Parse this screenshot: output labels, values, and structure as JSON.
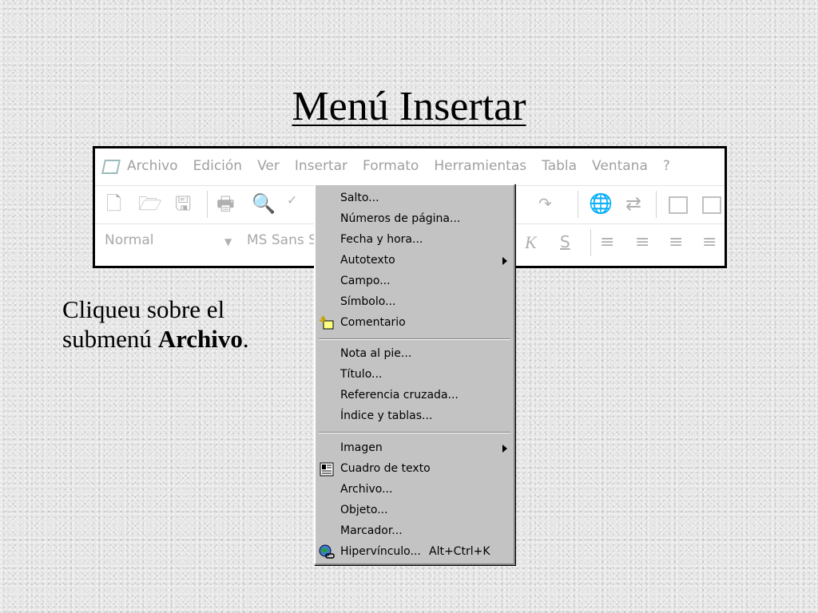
{
  "slide": {
    "title": "Menú Insertar",
    "caption_text": "Cliqueu sobre el submenú ",
    "caption_bold": "Archivo",
    "caption_end": "."
  },
  "menubar": {
    "items": [
      "Archivo",
      "Edición",
      "Ver",
      "Insertar",
      "Formato",
      "Herramientas",
      "Tabla",
      "Ventana",
      "?"
    ]
  },
  "formatting": {
    "style_value": "Normal",
    "font_value": "MS Sans S",
    "italic_label": "K",
    "underline_label": "S"
  },
  "insert_menu": {
    "group1": [
      {
        "label": "Salto...",
        "submenu": false,
        "icon": null
      },
      {
        "label": "Números de página...",
        "submenu": false,
        "icon": null
      },
      {
        "label": "Fecha y hora...",
        "submenu": false,
        "icon": null
      },
      {
        "label": "Autotexto",
        "submenu": true,
        "icon": null
      },
      {
        "label": "Campo...",
        "submenu": false,
        "icon": null
      },
      {
        "label": "Símbolo...",
        "submenu": false,
        "icon": null
      },
      {
        "label": "Comentario",
        "submenu": false,
        "icon": "comment-icon"
      }
    ],
    "group2": [
      {
        "label": "Nota al pie...",
        "submenu": false,
        "icon": null
      },
      {
        "label": "Título...",
        "submenu": false,
        "icon": null
      },
      {
        "label": "Referencia cruzada...",
        "submenu": false,
        "icon": null
      },
      {
        "label": "Índice y tablas...",
        "submenu": false,
        "icon": null
      }
    ],
    "group3": [
      {
        "label": "Imagen",
        "submenu": true,
        "icon": null
      },
      {
        "label": "Cuadro de texto",
        "submenu": false,
        "icon": "text-box-icon"
      },
      {
        "label": "Archivo...",
        "submenu": false,
        "icon": null
      },
      {
        "label": "Objeto...",
        "submenu": false,
        "icon": null
      },
      {
        "label": "Marcador...",
        "submenu": false,
        "icon": null
      },
      {
        "label": "Hipervínculo...",
        "submenu": false,
        "icon": "hyperlink-icon",
        "shortcut": "Alt+Ctrl+K"
      }
    ]
  },
  "colors": {
    "menu_background": "#c3c3c3",
    "disabled_text": "#a0a0a0"
  }
}
